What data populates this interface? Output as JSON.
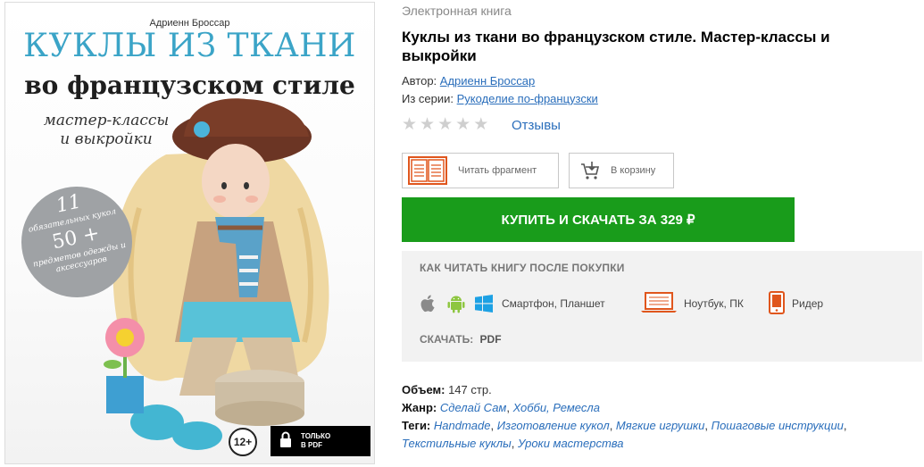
{
  "cover": {
    "author": "Адриенн Броссар",
    "title_line1": "КУКЛЫ ИЗ ТКАНИ",
    "title_line2": "во французском стиле",
    "subtitle_line1": "мастер-классы",
    "subtitle_line2": "и выкройки",
    "badge_num1": "11",
    "badge_text1": "обязательных кукол",
    "badge_num2": "50 +",
    "badge_text2": "предметов одежды и аксессуаров",
    "age_rating": "12+",
    "pdf_badge": "ТОЛЬКО В PDF"
  },
  "product": {
    "format_label": "Электронная книга",
    "title": "Куклы из ткани во французском стиле. Мастер-классы и выкройки",
    "author_label": "Автор:",
    "author_name": "Адриенн Броссар",
    "series_label": "Из серии:",
    "series_name": "Рукоделие по-французски",
    "rating_stars": 0,
    "reviews_link": "Отзывы"
  },
  "actions": {
    "read_fragment": "Читать фрагмент",
    "add_to_cart": "В корзину",
    "buy": "КУПИТЬ И СКАЧАТЬ ЗА 329 ₽"
  },
  "howto": {
    "heading": "КАК ЧИТАТЬ КНИГУ ПОСЛЕ ПОКУПКИ",
    "mobile_label": "Смартфон, Планшет",
    "laptop_label": "Ноутбук, ПК",
    "reader_label": "Ридер",
    "download_label": "СКАЧАТЬ:",
    "download_format": "PDF"
  },
  "details": {
    "volume_label": "Объем:",
    "volume_value": "147 стр.",
    "genre_label": "Жанр:",
    "genres": [
      "Сделай Сам",
      "Хобби, Ремесла"
    ],
    "tags_label": "Теги:",
    "tags": [
      "Handmade",
      "Изготовление кукол",
      "Мягкие игрушки",
      "Пошаговые инструкции",
      "Текстильные куклы",
      "Уроки мастерства"
    ]
  },
  "colors": {
    "buy_green": "#199c1b",
    "link_blue": "#2a6ebb",
    "cover_title_blue": "#3ba4c7",
    "device_orange": "#e0561d",
    "android_green": "#8dc63f",
    "windows_blue": "#1da1e4"
  },
  "icons": [
    "book-open-icon",
    "cart-icon",
    "apple-icon",
    "android-icon",
    "windows-icon",
    "laptop-icon",
    "ereader-icon",
    "lock-icon"
  ]
}
